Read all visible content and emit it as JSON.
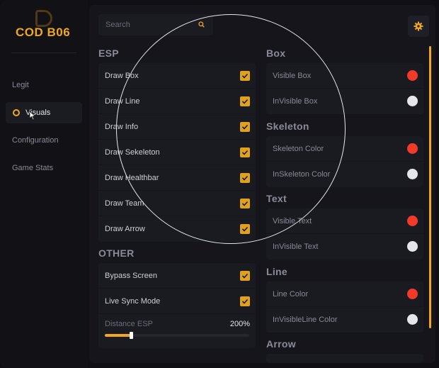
{
  "app": {
    "logo_text": "COD B06"
  },
  "sidebar": {
    "items": [
      {
        "label": "Legit",
        "active": false
      },
      {
        "label": "Visuals",
        "active": true
      },
      {
        "label": "Configuration",
        "active": false
      },
      {
        "label": "Game Stats",
        "active": false
      }
    ]
  },
  "search": {
    "placeholder": "Search"
  },
  "colors": {
    "accent": "#f0a81c",
    "red": "#f23a2a",
    "white": "#e6e6ea"
  },
  "esp": {
    "title": "ESP",
    "items": [
      {
        "label": "Draw Box",
        "checked": true
      },
      {
        "label": "Draw Line",
        "checked": true
      },
      {
        "label": "Draw Info",
        "checked": true
      },
      {
        "label": "Draw Sekeleton",
        "checked": true
      },
      {
        "label": "Draw Healthbar",
        "checked": true
      },
      {
        "label": "Draw Team",
        "checked": true
      },
      {
        "label": "Draw Arrow",
        "checked": true
      }
    ]
  },
  "other": {
    "title": "OTHER",
    "items": [
      {
        "label": "Bypass Screen",
        "checked": true
      },
      {
        "label": "Live Sync Mode",
        "checked": true
      }
    ],
    "slider": {
      "label": "Distance ESP",
      "value": "200%",
      "fraction": 0.18
    }
  },
  "box": {
    "title": "Box",
    "items": [
      {
        "label": "Visible Box",
        "color": "#f23a2a"
      },
      {
        "label": "InVisible Box",
        "color": "#e6e6ea"
      }
    ]
  },
  "skeleton": {
    "title": "Skeleton",
    "items": [
      {
        "label": "Skeleton Color",
        "color": "#f23a2a"
      },
      {
        "label": "InSkeleton Color",
        "color": "#e6e6ea"
      }
    ]
  },
  "text": {
    "title": "Text",
    "items": [
      {
        "label": "Visible Text",
        "color": "#f23a2a"
      },
      {
        "label": "InVisible Text",
        "color": "#e6e6ea"
      }
    ]
  },
  "line": {
    "title": "Line",
    "items": [
      {
        "label": "Line Color",
        "color": "#f23a2a"
      },
      {
        "label": "InVisibleLine Color",
        "color": "#e6e6ea"
      }
    ]
  },
  "arrow": {
    "title": "Arrow"
  },
  "icons": {
    "search": "search-icon",
    "settings": "gear-icon",
    "checkbox": "check-icon",
    "cursor": "mouse-cursor-icon"
  }
}
